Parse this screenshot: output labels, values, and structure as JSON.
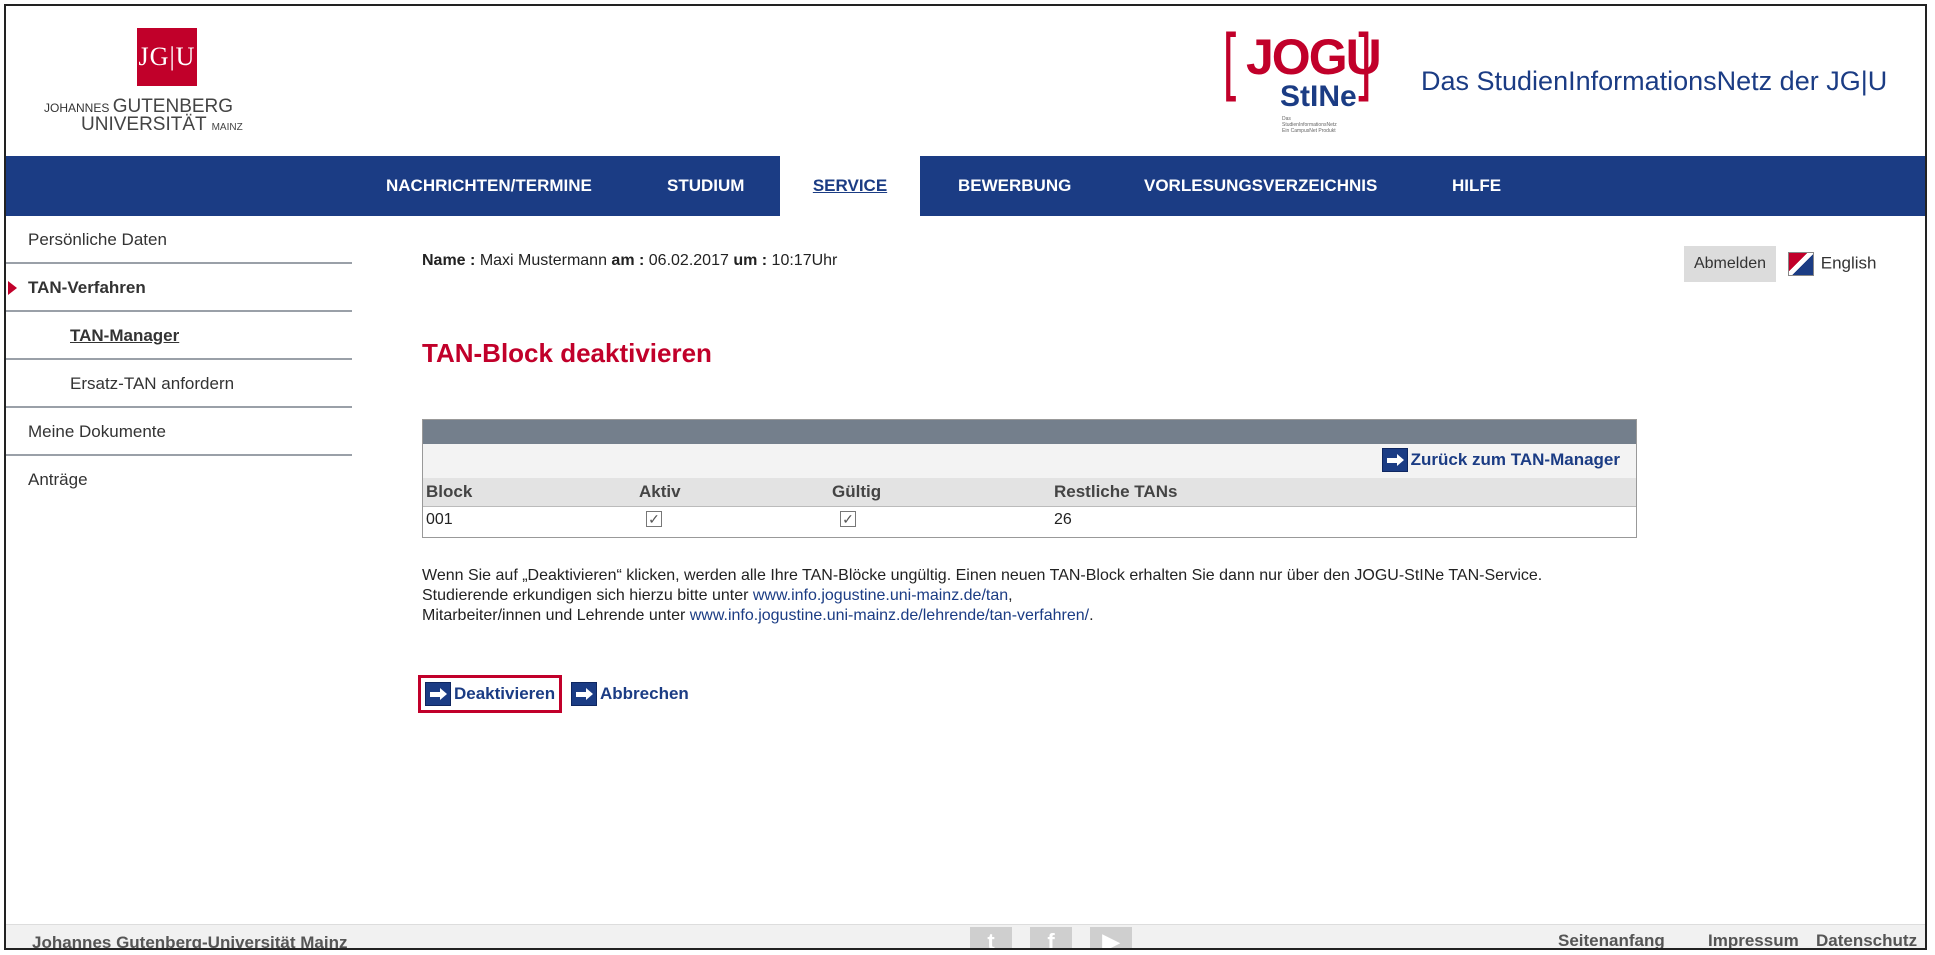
{
  "branding": {
    "jgu_mark": "JG|U",
    "jgu_line1_small": "JOHANNES",
    "jgu_line1_big": "GUTENBERG",
    "jgu_line2_big": "UNIVERSITÄT",
    "jgu_line2_small": "MAINZ",
    "jogu_text": "JOGU",
    "stine_text": "StINe",
    "stine_sub": "Das StudienInformationsNetz Ein CampusNet Produkt",
    "site_title": "Das StudienInformationsNetz der JG|U"
  },
  "nav": {
    "items": [
      {
        "label": "NACHRICHTEN/TERMINE"
      },
      {
        "label": "STUDIUM"
      },
      {
        "label": "SERVICE",
        "active": true
      },
      {
        "label": "BEWERBUNG"
      },
      {
        "label": "VORLESUNGSVERZEICHNIS"
      },
      {
        "label": "HILFE"
      }
    ]
  },
  "sidebar": {
    "items": [
      {
        "label": "Persönliche Daten"
      },
      {
        "label": "TAN-Verfahren",
        "expanded": true
      },
      {
        "label": "TAN-Manager",
        "current": true
      },
      {
        "label": "Ersatz-TAN anfordern"
      },
      {
        "label": "Meine Dokumente"
      },
      {
        "label": "Anträge"
      }
    ]
  },
  "user": {
    "name_label": "Name :",
    "name_value": "Maxi Mustermann",
    "am_label": "am :",
    "date": "06.02.2017",
    "um_label": "um :",
    "time": "10:17Uhr",
    "logout_label": "Abmelden",
    "language_label": "English"
  },
  "page": {
    "title": "TAN-Block deaktivieren"
  },
  "table": {
    "back_link": "Zurück zum TAN-Manager",
    "columns": [
      "Block",
      "Aktiv",
      "Gültig",
      "Restliche TANs"
    ],
    "rows": [
      {
        "block": "001",
        "aktiv": true,
        "gueltig": true,
        "restliche": "26"
      }
    ]
  },
  "info": {
    "line1": "Wenn Sie auf „Deaktivieren“ klicken, werden alle Ihre TAN-Blöcke ungültig. Einen neuen TAN-Block erhalten Sie dann nur über den JOGU-StINe TAN-Service.",
    "line2_prefix": "Studierende erkundigen sich hierzu bitte unter ",
    "link_students": "www.info.jogustine.uni-mainz.de/tan",
    "line2_suffix": ",",
    "line3_prefix": "Mitarbeiter/innen und Lehrende unter ",
    "link_staff": "www.info.jogustine.uni-mainz.de/lehrende/tan-verfahren/",
    "line3_suffix": "."
  },
  "actions": {
    "deactivate_label": "Deaktivieren",
    "cancel_label": "Abbrechen"
  },
  "footer": {
    "university": "Johannes Gutenberg-Universität Mainz",
    "social": [
      "twitter-icon",
      "facebook-icon",
      "youtube-icon"
    ],
    "links": [
      "Seitenanfang",
      "Impressum",
      "Datenschutz"
    ]
  },
  "colors": {
    "brand_blue": "#1b3c84",
    "brand_red": "#c1002a"
  }
}
